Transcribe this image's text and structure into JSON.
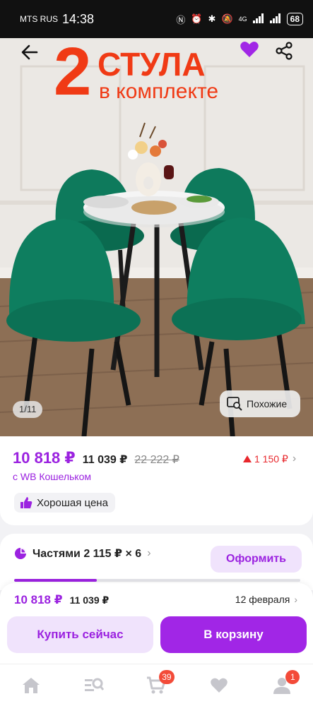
{
  "status_bar": {
    "carrier": "MTS RUS",
    "time": "14:38",
    "network": "4G",
    "battery": "68"
  },
  "hero": {
    "banner_number": "2",
    "banner_top": "СТУЛА",
    "banner_bottom": "в комплекте",
    "image_counter": "1/11",
    "similar_label": "Похожие"
  },
  "price": {
    "wallet_price": "10 818 ₽",
    "regular_price": "11 039 ₽",
    "old_price": "22 222 ₽",
    "wallet_note": "с WB Кошельком",
    "price_change": "1 150 ₽",
    "good_price_label": "Хорошая цена"
  },
  "installments": {
    "label": "Частями 2 115 ₽ × 6",
    "apply_label": "Оформить",
    "progress_fraction": 0.29
  },
  "buy_panel": {
    "wallet_price": "10 818 ₽",
    "regular_price": "11 039 ₽",
    "delivery_date": "12 февраля",
    "buy_now_label": "Купить сейчас",
    "add_to_cart_label": "В корзину"
  },
  "tab_bar": {
    "cart_badge": "39",
    "profile_badge": "1"
  },
  "colors": {
    "accent": "#a126e6",
    "price": "#9b22e0",
    "banner": "#f03a15",
    "price_change": "#e8272c",
    "chair": "#0e7a5c"
  }
}
